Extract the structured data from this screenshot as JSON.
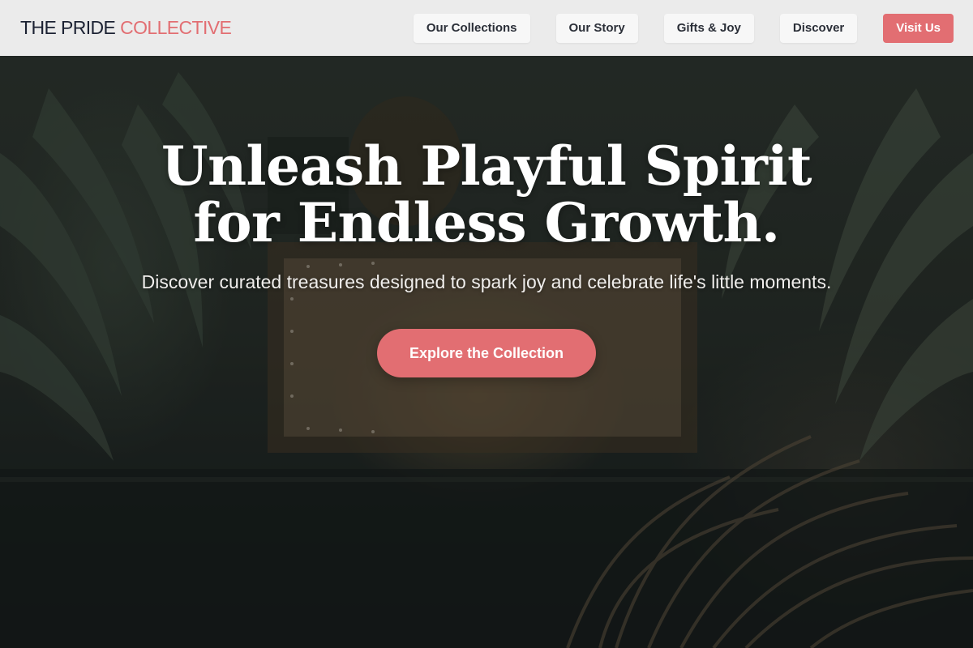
{
  "header": {
    "logo_main": "THE PRIDE ",
    "logo_accent": "COLLECTIVE",
    "nav": [
      {
        "label": "Our Collections"
      },
      {
        "label": "Our Story"
      },
      {
        "label": "Gifts & Joy"
      },
      {
        "label": "Discover"
      }
    ],
    "cta_label": "Visit Us"
  },
  "hero": {
    "title": "Unleash Playful Spirit for Endless Growth.",
    "subtitle": "Discover curated treasures designed to spark joy and celebrate life's little moments.",
    "cta_label": "Explore the Collection"
  },
  "colors": {
    "accent": "#e26e72",
    "header_bg": "#ebebeb",
    "logo_dark": "#1c2233",
    "nav_bg": "#f7f7f7"
  }
}
